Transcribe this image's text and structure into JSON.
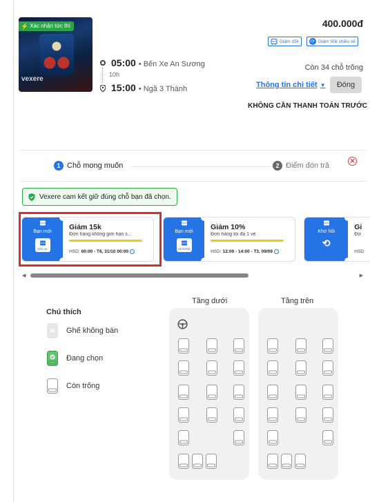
{
  "trip": {
    "instant_label": "Xác nhận tức thì",
    "thumbnail_brand": "vexere",
    "depart_time": "05:00",
    "depart_place": "• Bến Xe An Sương",
    "duration": "10h",
    "arrive_time": "15:00",
    "arrive_place": "• Ngã 3 Thành",
    "price": "400.000đ",
    "promos": [
      "Giảm 15k",
      "Giảm 50k chiều về"
    ],
    "seats_left": "Còn 34 chỗ trống",
    "detail_link": "Thông tin chi tiết",
    "close_button": "Đóng",
    "no_prepay": "KHÔNG CẦN THANH TOÁN TRƯỚC"
  },
  "steps": [
    {
      "num": "1",
      "label": "Chỗ mong muốn"
    },
    {
      "num": "2",
      "label": "Điểm đón trả"
    }
  ],
  "commitment": "Vexere cam kết giữ đúng chỗ bạn đã chọn.",
  "coupons": [
    {
      "tag": "Bạn mới",
      "icon_text": "Nhà xe",
      "title": "Giảm 15k",
      "desc": "Đơn hàng không giới hạn s...",
      "exp_prefix": "HSD:",
      "exp": "00:00 - T6, 31/10 00:00"
    },
    {
      "tag": "Bạn mới",
      "icon_text": "VEXERE",
      "title": "Giảm 10%",
      "desc": "Đơn hàng tối đa 1 vé",
      "exp_prefix": "HSD:",
      "exp": "12:00 - 14:00 - T3, 09/09"
    },
    {
      "tag": "Khứ hồi",
      "icon_text": "",
      "title": "Gi",
      "desc": "Đơ",
      "exp_prefix": "HSD",
      "exp": ""
    }
  ],
  "legend": {
    "title": "Chú thích",
    "items": [
      "Ghế không bán",
      "Đang chọn",
      "Còn trống"
    ]
  },
  "decks": {
    "lower_label": "Tầng dưới",
    "upper_label": "Tầng trên"
  },
  "colors": {
    "primary": "#2474e5",
    "success": "#28a745",
    "danger": "#d32f2f",
    "coupon_bar": "#f5c518"
  }
}
